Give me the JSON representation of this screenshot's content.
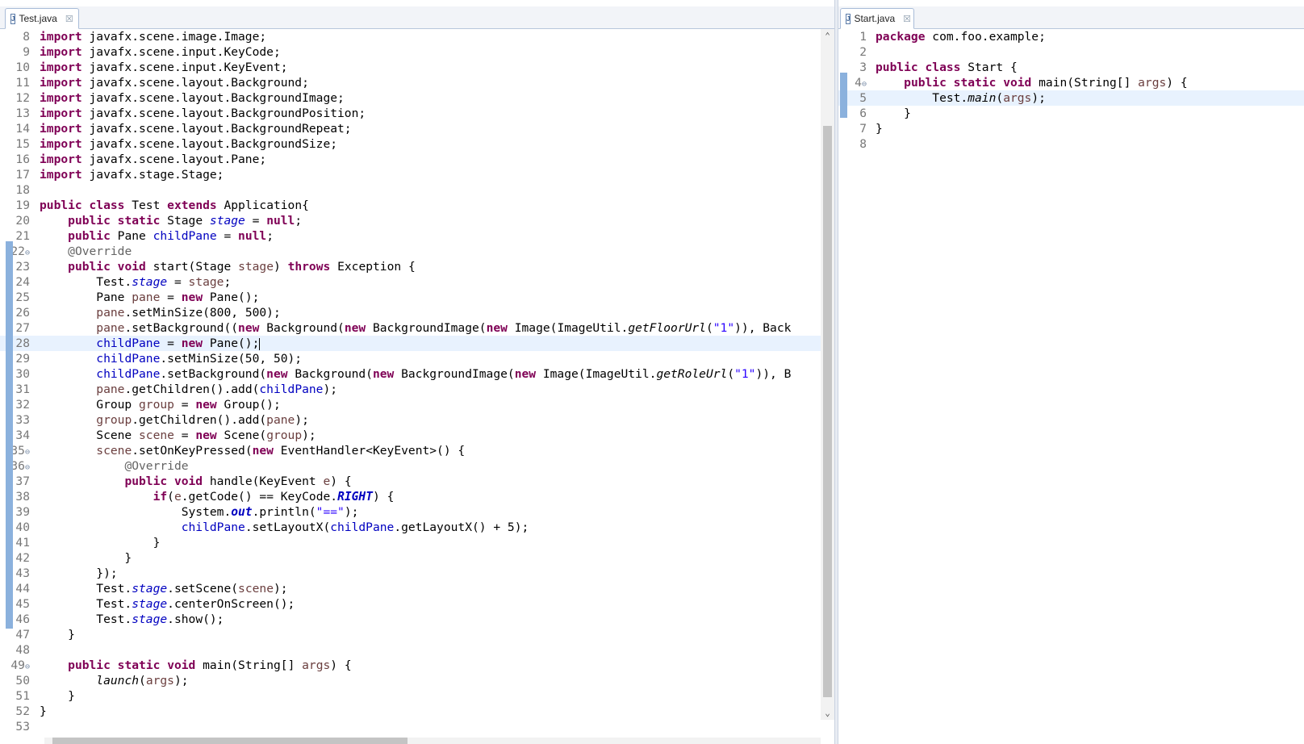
{
  "left_editor": {
    "tab": {
      "title": "Test.java",
      "close": "☒"
    },
    "lines": [
      {
        "n": "8",
        "code": "<span class='kw'>import</span> javafx.scene.image.Image;"
      },
      {
        "n": "9",
        "code": "<span class='kw'>import</span> javafx.scene.input.KeyCode;"
      },
      {
        "n": "10",
        "code": "<span class='kw'>import</span> javafx.scene.input.KeyEvent;"
      },
      {
        "n": "11",
        "code": "<span class='kw'>import</span> javafx.scene.layout.Background;"
      },
      {
        "n": "12",
        "code": "<span class='kw'>import</span> javafx.scene.layout.BackgroundImage;"
      },
      {
        "n": "13",
        "code": "<span class='kw'>import</span> javafx.scene.layout.BackgroundPosition;"
      },
      {
        "n": "14",
        "code": "<span class='kw'>import</span> javafx.scene.layout.BackgroundRepeat;"
      },
      {
        "n": "15",
        "code": "<span class='kw'>import</span> javafx.scene.layout.BackgroundSize;"
      },
      {
        "n": "16",
        "code": "<span class='kw'>import</span> javafx.scene.layout.Pane;"
      },
      {
        "n": "17",
        "code": "<span class='kw'>import</span> javafx.stage.Stage;"
      },
      {
        "n": "18",
        "code": ""
      },
      {
        "n": "19",
        "code": "<span class='kw'>public</span> <span class='kw'>class</span> Test <span class='kw'>extends</span> Application{"
      },
      {
        "n": "20",
        "code": "    <span class='kw'>public</span> <span class='kw'>static</span> Stage <span class='sfld'>stage</span> = <span class='kw'>null</span>;"
      },
      {
        "n": "21",
        "code": "    <span class='kw'>public</span> Pane <span class='fld'>childPane</span> = <span class='kw'>null</span>;"
      },
      {
        "n": "22",
        "fold": "⊖",
        "code": "    <span class='ann'>@Override</span>"
      },
      {
        "n": "23",
        "code": "    <span class='kw'>public</span> <span class='kw'>void</span> start(Stage <span class='var'>stage</span>) <span class='kw'>throws</span> Exception {"
      },
      {
        "n": "24",
        "code": "        Test.<span class='sfld'>stage</span> = <span class='var'>stage</span>;"
      },
      {
        "n": "25",
        "code": "        Pane <span class='var'>pane</span> = <span class='kw'>new</span> Pane();"
      },
      {
        "n": "26",
        "code": "        <span class='var'>pane</span>.setMinSize(800, 500);"
      },
      {
        "n": "27",
        "code": "        <span class='var'>pane</span>.setBackground((<span class='kw'>new</span> Background(<span class='kw'>new</span> BackgroundImage(<span class='kw'>new</span> Image(ImageUtil.<span class='sm'>getFloorUrl</span>(<span class='str'>\"1\"</span>)), Back"
      },
      {
        "n": "28",
        "hl": true,
        "code": "        <span class='fld'>childPane</span> = <span class='kw'>new</span> Pane();<span class='cursor'></span>"
      },
      {
        "n": "29",
        "code": "        <span class='fld'>childPane</span>.setMinSize(50, 50);"
      },
      {
        "n": "30",
        "code": "        <span class='fld'>childPane</span>.setBackground(<span class='kw'>new</span> Background(<span class='kw'>new</span> BackgroundImage(<span class='kw'>new</span> Image(ImageUtil.<span class='sm'>getRoleUrl</span>(<span class='str'>\"1\"</span>)), B"
      },
      {
        "n": "31",
        "code": "        <span class='var'>pane</span>.getChildren().add(<span class='fld'>childPane</span>);"
      },
      {
        "n": "32",
        "code": "        Group <span class='var'>group</span> = <span class='kw'>new</span> Group();"
      },
      {
        "n": "33",
        "code": "        <span class='var'>group</span>.getChildren().add(<span class='var'>pane</span>);"
      },
      {
        "n": "34",
        "code": "        Scene <span class='var'>scene</span> = <span class='kw'>new</span> Scene(<span class='var'>group</span>);"
      },
      {
        "n": "35",
        "fold": "⊖",
        "code": "        <span class='var'>scene</span>.setOnKeyPressed(<span class='kw'>new</span> EventHandler&lt;KeyEvent&gt;() {"
      },
      {
        "n": "36",
        "fold": "⊖",
        "code": "            <span class='ann'>@Override</span>"
      },
      {
        "n": "37",
        "code": "            <span class='kw'>public</span> <span class='kw'>void</span> handle(KeyEvent <span class='var'>e</span>) {"
      },
      {
        "n": "38",
        "code": "                <span class='kw'>if</span>(<span class='var'>e</span>.getCode() == KeyCode.<span class='bfld'>RIGHT</span>) {"
      },
      {
        "n": "39",
        "code": "                    System.<span class='bfld'>out</span>.println(<span class='str'>\"==\"</span>);"
      },
      {
        "n": "40",
        "code": "                    <span class='fld'>childPane</span>.setLayoutX(<span class='fld'>childPane</span>.getLayoutX() + 5);"
      },
      {
        "n": "41",
        "code": "                }"
      },
      {
        "n": "42",
        "code": "            }"
      },
      {
        "n": "43",
        "code": "        });"
      },
      {
        "n": "44",
        "code": "        Test.<span class='sfld'>stage</span>.setScene(<span class='var'>scene</span>);"
      },
      {
        "n": "45",
        "code": "        Test.<span class='sfld'>stage</span>.centerOnScreen();"
      },
      {
        "n": "46",
        "code": "        Test.<span class='sfld'>stage</span>.show();"
      },
      {
        "n": "47",
        "code": "    }"
      },
      {
        "n": "48",
        "code": ""
      },
      {
        "n": "49",
        "fold": "⊖",
        "code": "    <span class='kw'>public</span> <span class='kw'>static</span> <span class='kw'>void</span> main(String[] <span class='var'>args</span>) {"
      },
      {
        "n": "50",
        "code": "        <span class='sm'>launch</span>(<span class='var'>args</span>);"
      },
      {
        "n": "51",
        "code": "    }"
      },
      {
        "n": "52",
        "code": "}"
      },
      {
        "n": "53",
        "code": ""
      }
    ]
  },
  "right_editor": {
    "tab": {
      "title": "Start.java",
      "close": "☒"
    },
    "lines": [
      {
        "n": "1",
        "code": "<span class='kw'>package</span> com.foo.example;"
      },
      {
        "n": "2",
        "code": ""
      },
      {
        "n": "3",
        "code": "<span class='kw'>public</span> <span class='kw'>class</span> Start {"
      },
      {
        "n": "4",
        "fold": "⊖",
        "code": "    <span class='kw'>public</span> <span class='kw'>static</span> <span class='kw'>void</span> main(String[] <span class='var'>args</span>) {"
      },
      {
        "n": "5",
        "hl": true,
        "code": "        Test.<span class='sm'>main</span>(<span class='var'>args</span>);"
      },
      {
        "n": "6",
        "code": "    }"
      },
      {
        "n": "7",
        "code": "}"
      },
      {
        "n": "8",
        "code": ""
      }
    ]
  },
  "colors": {
    "keyword": "#7f0055",
    "field": "#0000c0",
    "string": "#2a00ff",
    "local_var": "#6a3e3e",
    "annotation": "#646464",
    "line_highlight": "#e8f2fe"
  }
}
